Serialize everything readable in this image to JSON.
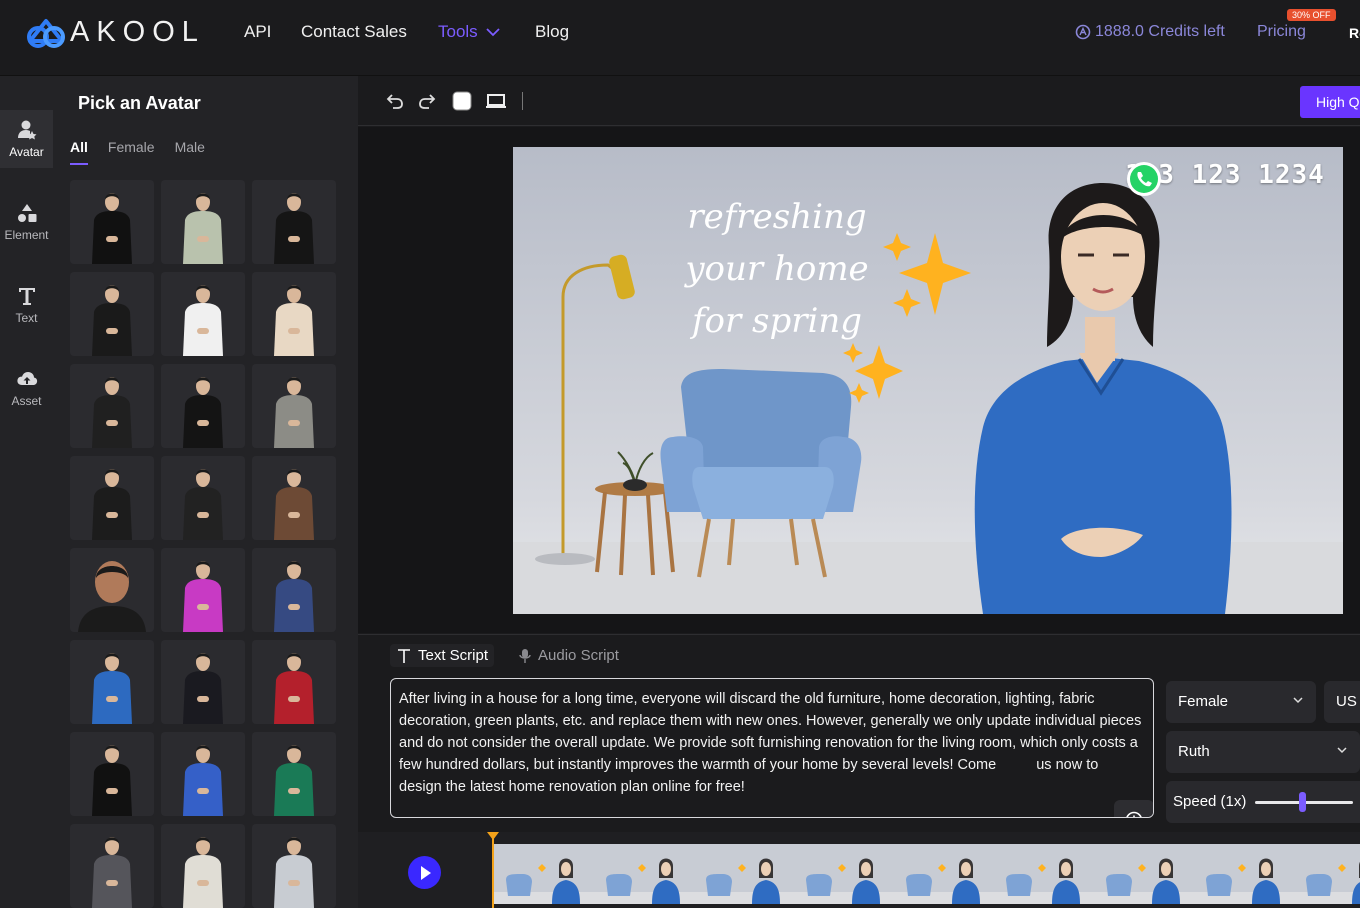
{
  "brand": {
    "name": "AKOOL"
  },
  "nav": {
    "links": [
      "API",
      "Contact Sales",
      "Tools",
      "Blog"
    ],
    "credits": "1888.0 Credits left",
    "pricing": "Pricing",
    "discount_badge": "30% OFF",
    "cut_off_link": "Re"
  },
  "rail": {
    "items": [
      {
        "label": "Avatar",
        "icon": "avatar-icon"
      },
      {
        "label": "Element",
        "icon": "shapes-icon"
      },
      {
        "label": "Text",
        "icon": "text-icon"
      },
      {
        "label": "Asset",
        "icon": "cloud-upload-icon"
      }
    ]
  },
  "panel": {
    "title": "Pick an Avatar",
    "filters": [
      "All",
      "Female",
      "Male"
    ],
    "active_filter": "All"
  },
  "toolbar": {
    "quality_button": "High Q",
    "icons": [
      "undo-icon",
      "redo-icon",
      "background-color-icon",
      "aspect-ratio-icon"
    ]
  },
  "canvas": {
    "phone": "123 123 1234",
    "headline": [
      "refreshing",
      "your home",
      "for spring"
    ]
  },
  "script": {
    "tabs": [
      "Text Script",
      "Audio Script"
    ],
    "active_tab": "Text Script",
    "text": "After living in a house for a long time, everyone will discard the old furniture, home decoration, lighting, fabric decoration, green plants, etc. and replace them with new ones. However, generally we only update individual pieces and do not consider the overall update. We provide soft furnishing renovation for the living room, which only costs a few hundred dollars, but instantly improves the warmth of your home by several levels! Come",
    "text_tail": "us",
    "text_end": "now to design the latest home renovation plan online for free!",
    "gender": "Female",
    "language": "US",
    "voice": "Ruth",
    "speed_label": "Speed (1x)",
    "speed_value": 0.48
  },
  "colors": {
    "accent": "#7b5cff",
    "primary_button": "#6a35ff",
    "badge": "#e8502e",
    "playhead": "#f3a21a"
  }
}
